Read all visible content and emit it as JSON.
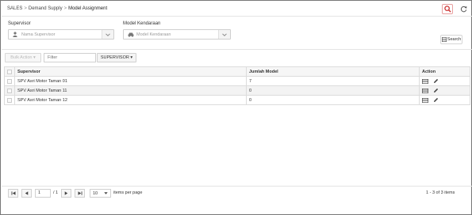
{
  "breadcrumb": {
    "items": [
      "SALES",
      "Demand Supply",
      "Model Assignment"
    ],
    "separator": ">"
  },
  "header_actions": {
    "search_icon": "search-icon",
    "refresh_icon": "refresh-icon",
    "accent_color": "#cc3333"
  },
  "filters": {
    "supervisor": {
      "label": "Supervisor",
      "placeholder": "Nama Supervisor",
      "icon": "user-icon"
    },
    "model": {
      "label": "Model Kendaraan",
      "placeholder": "Model Kendaraan",
      "icon": "car-icon"
    },
    "search_button": "Search"
  },
  "toolbar": {
    "bulk_action": "Bulk Action ▾",
    "filter_placeholder": "Filter",
    "column_dropdown": "SUPERVISOR ▾"
  },
  "table": {
    "columns": [
      "Supervisor",
      "Jumlah Model",
      "Action"
    ],
    "rows": [
      {
        "supervisor": "SPV Asri Motor Taman 01",
        "jumlah_model": "7"
      },
      {
        "supervisor": "SPV Asri Motor Taman 11",
        "jumlah_model": "0"
      },
      {
        "supervisor": "SPV Asri Motor Taman 12",
        "jumlah_model": "0"
      }
    ],
    "row_action_icons": [
      "list-icon",
      "pencil-icon"
    ]
  },
  "pager": {
    "current_page": "1",
    "of_text": "/ 1",
    "page_size": "10",
    "items_per_page": "items per page",
    "info": "1 - 3 of 3 items"
  }
}
